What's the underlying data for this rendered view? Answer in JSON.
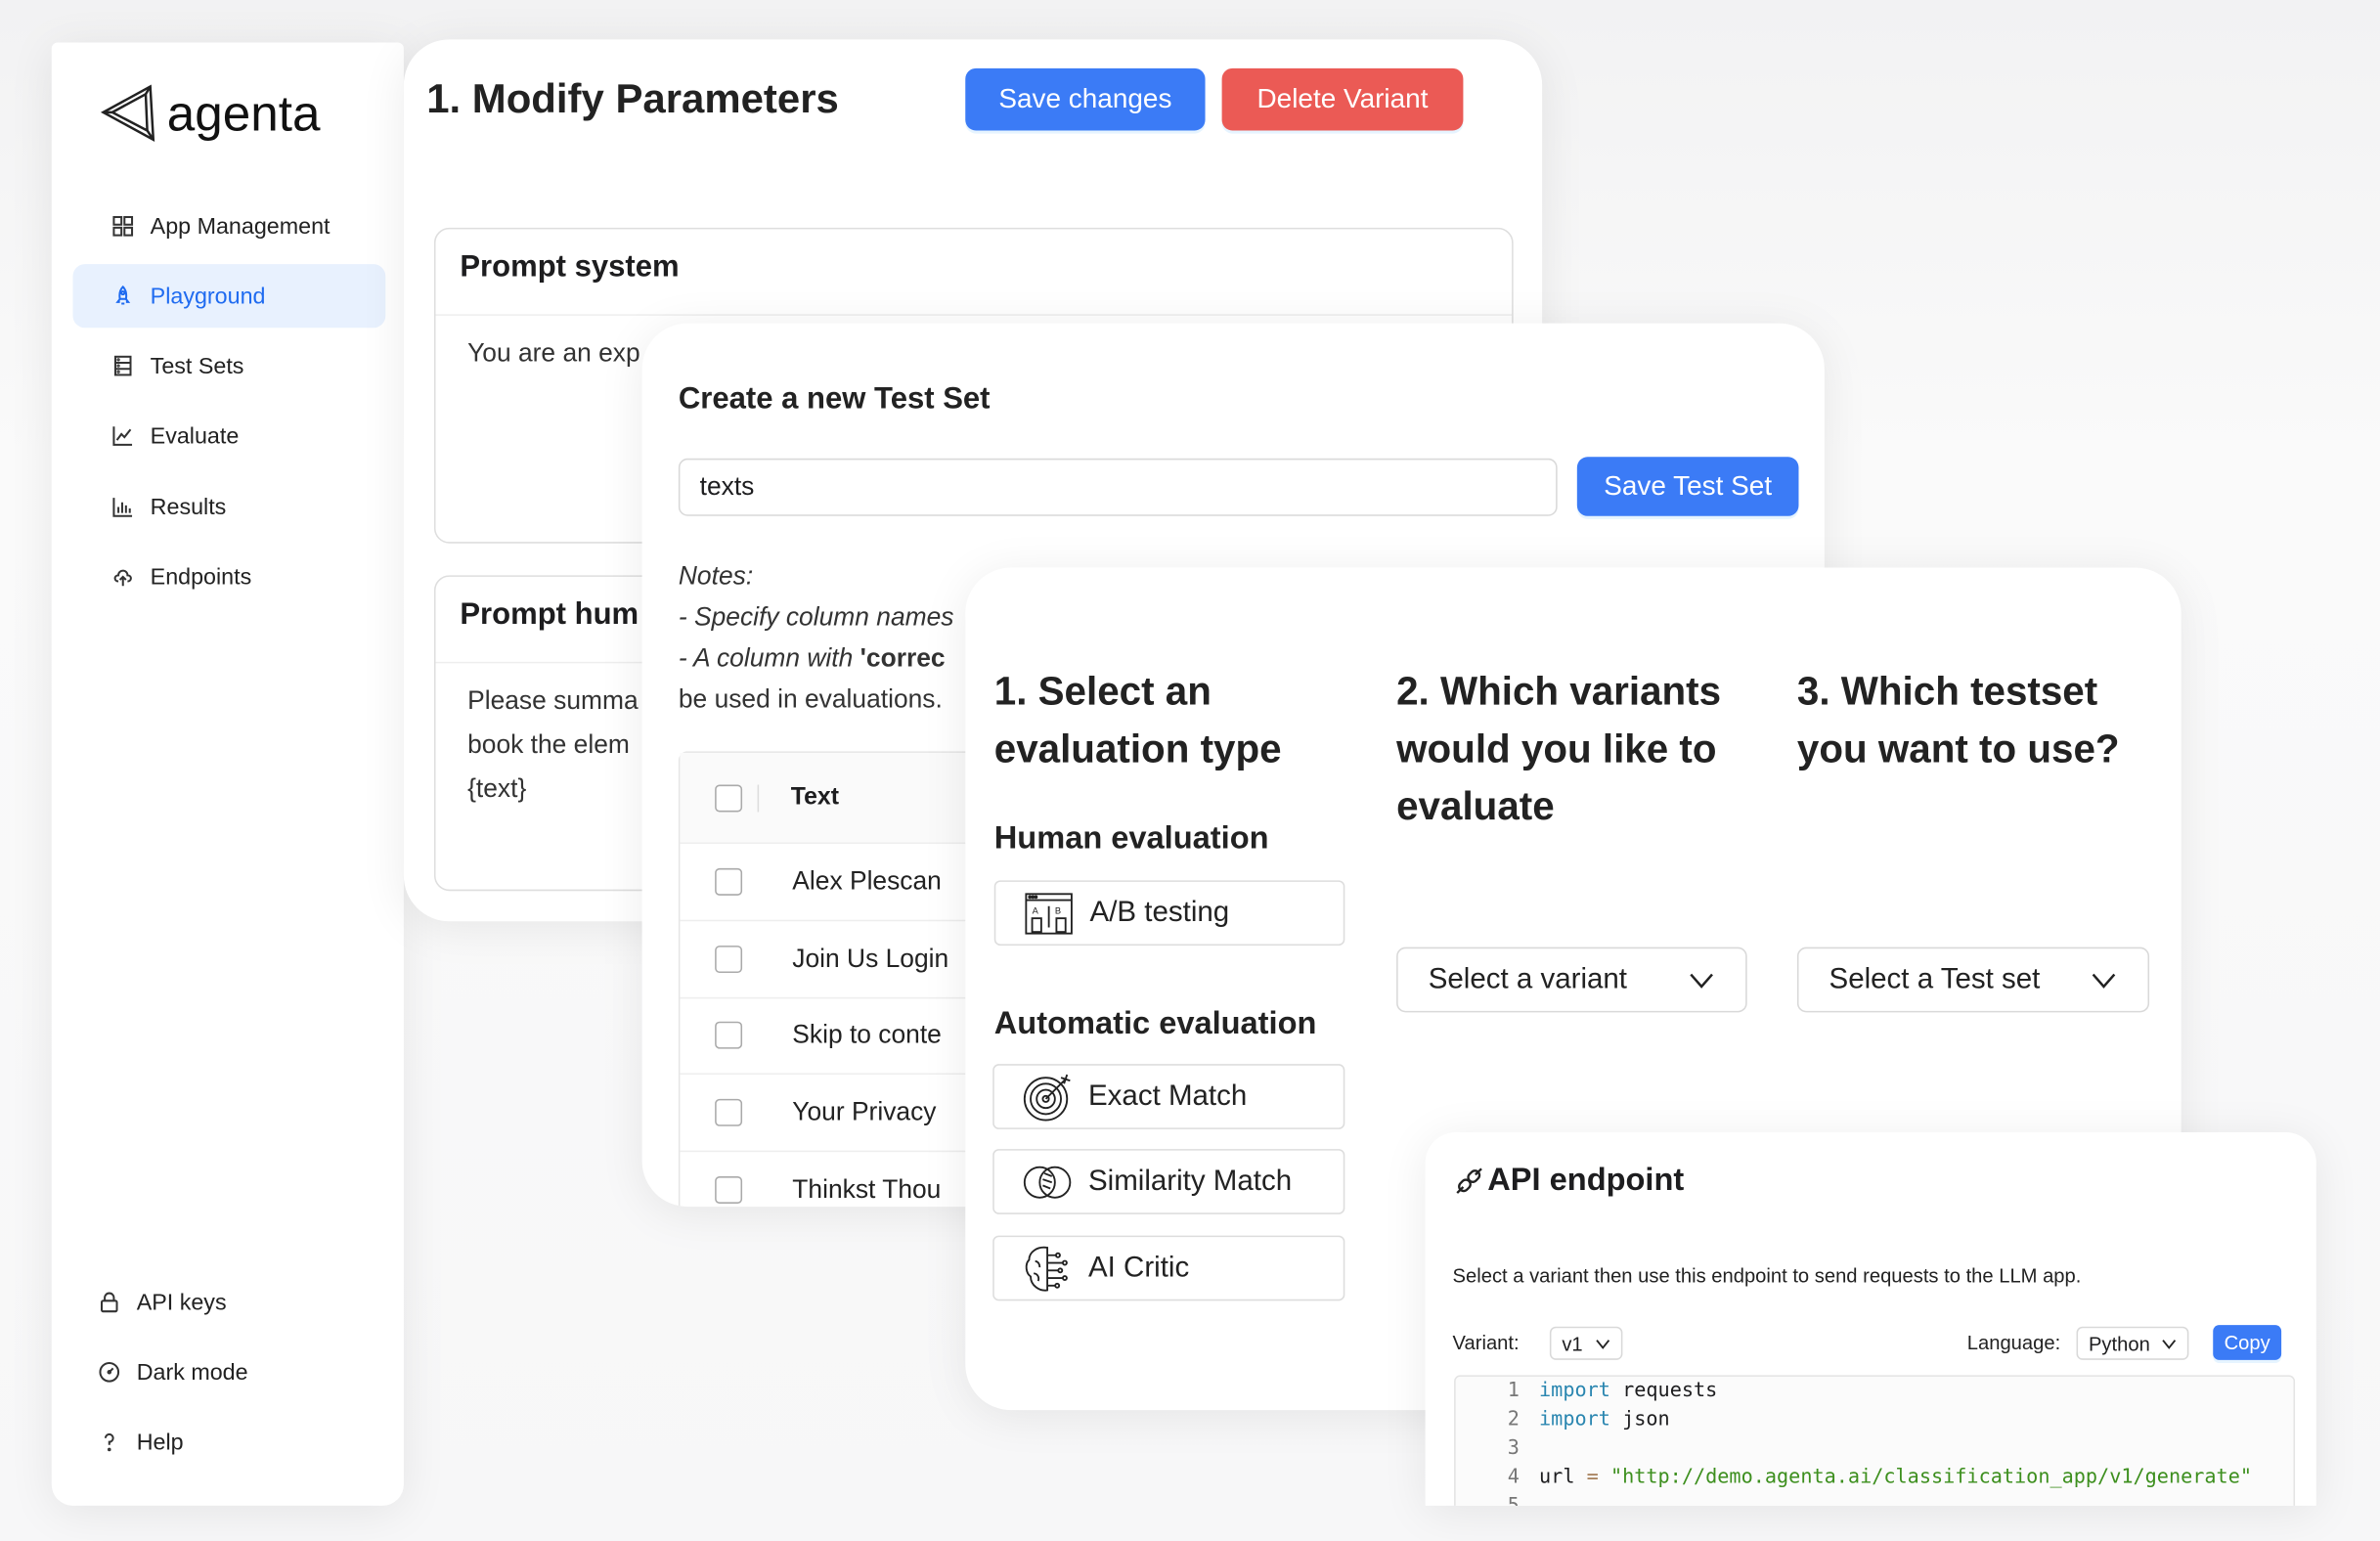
{
  "sidebar": {
    "logo": "agenta",
    "items": [
      {
        "label": "App Management",
        "icon": "grid-icon"
      },
      {
        "label": "Playground",
        "icon": "rocket-icon",
        "active": true
      },
      {
        "label": "Test Sets",
        "icon": "database-icon"
      },
      {
        "label": "Evaluate",
        "icon": "line-chart-icon"
      },
      {
        "label": "Results",
        "icon": "bar-chart-icon"
      },
      {
        "label": "Endpoints",
        "icon": "cloud-upload-icon"
      }
    ],
    "bottom": [
      {
        "label": "API keys",
        "icon": "lock-icon"
      },
      {
        "label": "Dark mode",
        "icon": "dashboard-icon"
      },
      {
        "label": "Help",
        "icon": "question-icon"
      }
    ]
  },
  "playground": {
    "title": "1. Modify Parameters",
    "save_label": "Save changes",
    "delete_label": "Delete Variant",
    "prompt_system": {
      "title": "Prompt system",
      "text": "You are an exp"
    },
    "prompt_human": {
      "title": "Prompt hum",
      "lines": [
        "Please summa",
        "book the elem",
        "{text}"
      ]
    }
  },
  "testset": {
    "title": "Create a new Test Set",
    "name_value": "texts",
    "save_label": "Save Test Set",
    "notes_title": "Notes:",
    "note1": "- Specify column names",
    "note2_prefix": "- A column with ",
    "note2_bold": "'correc",
    "note3": "be used in evaluations.",
    "column": "Text",
    "rows": [
      "Alex Plescan",
      "Join Us Login",
      "Skip to conte",
      "Your Privacy",
      "Thinkst Thou"
    ]
  },
  "evaluation": {
    "col1_title": [
      "1. Select an",
      "evaluation type"
    ],
    "col2_title": [
      "2. Which variants",
      "would you like to",
      "evaluate"
    ],
    "col3_title": [
      "3. Which testset",
      "you want to use?"
    ],
    "human_title": "Human evaluation",
    "human_options": [
      {
        "label": "A/B testing",
        "icon": "ab-testing-icon"
      }
    ],
    "auto_title": "Automatic evaluation",
    "auto_options": [
      {
        "label": "Exact Match",
        "icon": "target-icon"
      },
      {
        "label": "Similarity Match",
        "icon": "venn-icon"
      },
      {
        "label": "AI Critic",
        "icon": "brain-icon"
      }
    ],
    "variant_placeholder": "Select a variant",
    "testset_placeholder": "Select a Test set"
  },
  "api": {
    "title": "API endpoint",
    "description": "Select a variant then use this endpoint to send requests to the LLM app.",
    "variant_label": "Variant:",
    "variant_value": "v1",
    "language_label": "Language:",
    "language_value": "Python",
    "copy_label": "Copy",
    "code": {
      "l1_kw": "import",
      "l1_rest": " requests",
      "l2_kw": "import",
      "l2_rest": " json",
      "l4_var": "url ",
      "l4_op": "=",
      "l4_str": " \"http://demo.agenta.ai/classification_app/v1/generate\""
    }
  },
  "colors": {
    "primary": "#3b7bf6",
    "danger": "#eb5a55",
    "active_bg": "#e8f1fe"
  }
}
